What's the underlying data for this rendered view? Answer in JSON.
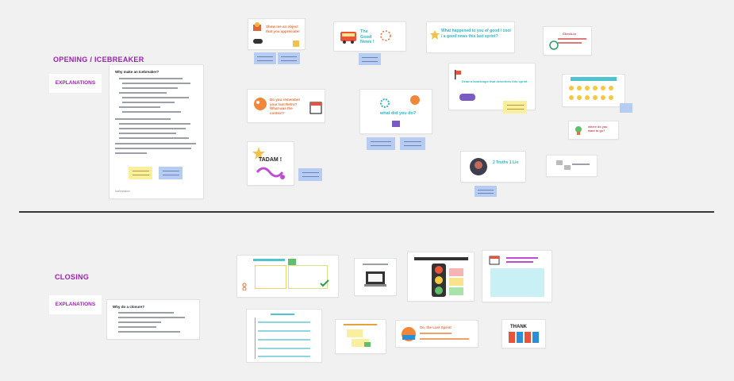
{
  "sections": {
    "opening": {
      "title": "OPENING / ICEBREAKER",
      "explanations_label": "EXPLANATIONS",
      "doc_heading": "Why make an Icebreaker?",
      "doc_footer": "Icebreaker"
    },
    "closing": {
      "title": "CLOSING",
      "explanations_label": "EXPLANATIONS",
      "doc_heading": "Why do a closure?"
    }
  },
  "opening_cards": {
    "show_object": "Show me an object that you appreciate!",
    "good_news": "The Good News !",
    "what_happened": "What happened to you of good / cool / a good news this last sprint?",
    "done_retro": "Do you remember your last Retro? What was the context?",
    "draw_landscape": "Draw a landscape that describes this sprint",
    "what_did_you_do": "what did you do?",
    "tadam": "TADAM !",
    "two_truths": "2 Truths 1 Lie",
    "where_go": "where do you want to go?",
    "teams_check": "Check-in"
  },
  "closing_cards": {
    "last_sprint": "So, the Last Sprint",
    "thank": "THANK"
  },
  "colors": {
    "accent": "#9b1fb0",
    "sticky_blue": "#b6ccf2",
    "sticky_yellow": "#faef9c",
    "canvas": "#f1f1f1"
  }
}
